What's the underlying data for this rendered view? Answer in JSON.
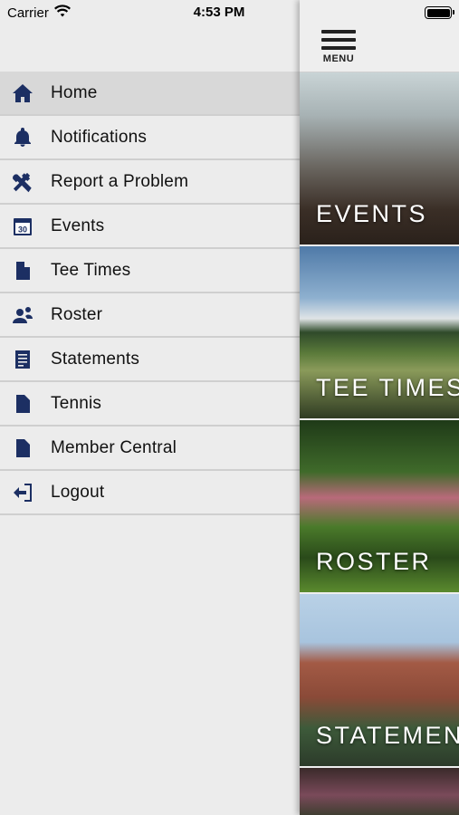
{
  "status_bar": {
    "carrier": "Carrier",
    "time": "4:53 PM",
    "icons": {
      "wifi": "wifi-icon",
      "battery": "battery-icon"
    }
  },
  "drawer": {
    "items": [
      {
        "label": "Home",
        "icon": "home-icon",
        "selected": true
      },
      {
        "label": "Notifications",
        "icon": "bell-icon"
      },
      {
        "label": "Report a Problem",
        "icon": "tools-icon"
      },
      {
        "label": "Events",
        "icon": "calendar-icon"
      },
      {
        "label": "Tee Times",
        "icon": "document-icon"
      },
      {
        "label": "Roster",
        "icon": "people-icon"
      },
      {
        "label": "Statements",
        "icon": "statement-icon"
      },
      {
        "label": "Tennis",
        "icon": "document-icon"
      },
      {
        "label": "Member Central",
        "icon": "document-icon"
      },
      {
        "label": "Logout",
        "icon": "logout-icon"
      }
    ],
    "calendar_day": "30",
    "icon_color": "#1c2f63"
  },
  "main": {
    "menu_button_label": "MENU",
    "tiles": [
      {
        "label": "EVENTS"
      },
      {
        "label": "TEE TIMES"
      },
      {
        "label": "ROSTER"
      },
      {
        "label": "STATEMENTS"
      }
    ]
  }
}
